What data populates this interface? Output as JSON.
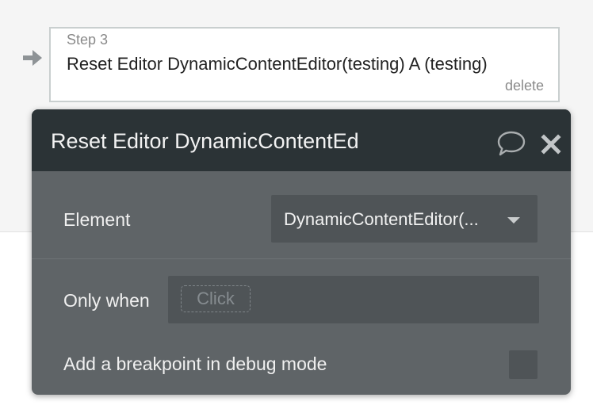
{
  "step": {
    "label": "Step 3",
    "title": "Reset Editor DynamicContentEditor(testing) A (testing)",
    "delete_label": "delete"
  },
  "panel": {
    "title": "Reset Editor DynamicContentEd",
    "element_label": "Element",
    "element_value": "DynamicContentEditor(...",
    "only_when_label": "Only when",
    "only_when_placeholder": "Click",
    "breakpoint_label": "Add a breakpoint in debug mode",
    "breakpoint_checked": false,
    "comment_icon": "speech-bubble-icon",
    "close_icon": "close-x-icon"
  },
  "colors": {
    "header_bg": "#2b3336",
    "panel_bg": "#5f6467",
    "input_bg": "#4f5457",
    "step_border": "#c9cfcf"
  }
}
